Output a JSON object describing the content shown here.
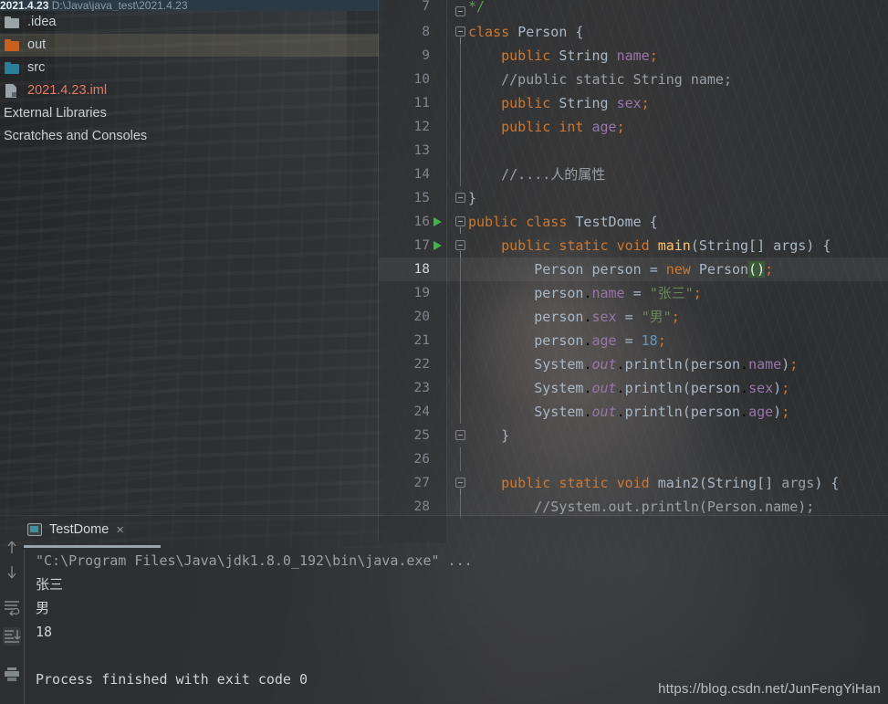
{
  "titlebar": {
    "project": "2021.4.23",
    "path": "D:\\Java\\java_test\\2021.4.23"
  },
  "project_tree": {
    "items": [
      {
        "label": ".idea",
        "icon": "folder-icon",
        "color": "#9aa3a8",
        "selected": false,
        "kind": "folder"
      },
      {
        "label": "out",
        "icon": "folder-icon",
        "color": "#c9601f",
        "selected": true,
        "kind": "folder"
      },
      {
        "label": "src",
        "icon": "folder-icon",
        "color": "#2b7f99",
        "selected": false,
        "kind": "folder"
      },
      {
        "label": "2021.4.23.iml",
        "icon": "module-file-icon",
        "color": "#e07b68",
        "selected": false,
        "kind": "module"
      },
      {
        "label": "External Libraries",
        "icon": "",
        "color": "#c9d1d6",
        "selected": false,
        "kind": "plain"
      },
      {
        "label": "Scratches and Consoles",
        "icon": "",
        "color": "#c9d1d6",
        "selected": false,
        "kind": "plain"
      }
    ]
  },
  "editor": {
    "current_line": 18,
    "lines": [
      {
        "n": "7",
        "run": false,
        "fold": "close",
        "html": "<span class=\"cmt2\">*/</span>",
        "partial": true
      },
      {
        "n": "8",
        "run": false,
        "fold": "open",
        "html": "<span class=\"kw\">class</span> <span class=\"typ\">Person</span> <span class=\"brc\">{</span>"
      },
      {
        "n": "9",
        "run": false,
        "fold": "",
        "html": "    <span class=\"kw\">public</span> <span class=\"typ\">String</span> <span class=\"fld\">name</span><span class=\"sem\">;</span>"
      },
      {
        "n": "10",
        "run": false,
        "fold": "",
        "html": "    <span class=\"cmt\">//public static String name;</span>"
      },
      {
        "n": "11",
        "run": false,
        "fold": "",
        "html": "    <span class=\"kw\">public</span> <span class=\"typ\">String</span> <span class=\"fld\">sex</span><span class=\"sem\">;</span>"
      },
      {
        "n": "12",
        "run": false,
        "fold": "",
        "html": "    <span class=\"kw\">public</span> <span class=\"kw\">int</span> <span class=\"fld\">age</span><span class=\"sem\">;</span>"
      },
      {
        "n": "13",
        "run": false,
        "fold": "",
        "html": ""
      },
      {
        "n": "14",
        "run": false,
        "fold": "",
        "html": "    <span class=\"cmt\">//....人的属性</span>"
      },
      {
        "n": "15",
        "run": false,
        "fold": "close",
        "html": "<span class=\"brc\">}</span>"
      },
      {
        "n": "16",
        "run": true,
        "fold": "open",
        "html": "<span class=\"kw\">public</span> <span class=\"kw\">class</span> <span class=\"typ\">TestDome</span> <span class=\"brc\">{</span>"
      },
      {
        "n": "17",
        "run": true,
        "fold": "open",
        "html": "    <span class=\"kw\">public</span> <span class=\"kw\">static</span> <span class=\"kw\">void</span> <span class=\"mtd\">main</span><span class=\"brc\">(</span><span class=\"typ\">String[]</span> <span class=\"pln\">args</span><span class=\"brc\">) {</span>"
      },
      {
        "n": "18",
        "run": false,
        "fold": "",
        "html": "        <span class=\"typ\">Person</span> <span class=\"pln\">person</span> <span class=\"pln\">=</span> <span class=\"kw\">new</span> <span class=\"typ\">Person</span><span class=\"brcmatch\">()</span><span class=\"sem\">;</span>"
      },
      {
        "n": "19",
        "run": false,
        "fold": "",
        "html": "        <span class=\"pln\">person</span>.<span class=\"fld\">name</span> <span class=\"pln\">=</span> <span class=\"str\">\"张三\"</span><span class=\"sem\">;</span>"
      },
      {
        "n": "20",
        "run": false,
        "fold": "",
        "html": "        <span class=\"pln\">person</span>.<span class=\"fld\">sex</span> <span class=\"pln\">=</span> <span class=\"str\">\"男\"</span><span class=\"sem\">;</span>"
      },
      {
        "n": "21",
        "run": false,
        "fold": "",
        "html": "        <span class=\"pln\">person</span>.<span class=\"fld\">age</span> <span class=\"pln\">=</span> <span class=\"num\">18</span><span class=\"sem\">;</span>"
      },
      {
        "n": "22",
        "run": false,
        "fold": "",
        "html": "        <span class=\"typ\">System</span>.<span class=\"sfld\">out</span>.<span class=\"pln\">println</span><span class=\"brc\">(</span><span class=\"pln\">person</span>.<span class=\"fld\">name</span><span class=\"brc\">)</span><span class=\"sem\">;</span>"
      },
      {
        "n": "23",
        "run": false,
        "fold": "",
        "html": "        <span class=\"typ\">System</span>.<span class=\"sfld\">out</span>.<span class=\"pln\">println</span><span class=\"brc\">(</span><span class=\"pln\">person</span>.<span class=\"fld\">sex</span><span class=\"brc\">)</span><span class=\"sem\">;</span>"
      },
      {
        "n": "24",
        "run": false,
        "fold": "",
        "html": "        <span class=\"typ\">System</span>.<span class=\"sfld\">out</span>.<span class=\"pln\">println</span><span class=\"brc\">(</span><span class=\"pln\">person</span>.<span class=\"fld\">age</span><span class=\"brc\">)</span><span class=\"sem\">;</span>"
      },
      {
        "n": "25",
        "run": false,
        "fold": "close",
        "html": "    <span class=\"brc\">}</span>"
      },
      {
        "n": "26",
        "run": false,
        "fold": "",
        "html": ""
      },
      {
        "n": "27",
        "run": false,
        "fold": "open",
        "html": "    <span class=\"kw\">public</span> <span class=\"kw\">static</span> <span class=\"kw\">void</span> <span class=\"pln\">main2</span><span class=\"brc\">(</span><span class=\"typ\">String[]</span> <span class=\"cmt\">args</span><span class=\"brc\">) {</span>"
      },
      {
        "n": "28",
        "run": false,
        "fold": "",
        "html": "        <span class=\"cmt\">//System.out.println(Person.name);</span>"
      }
    ]
  },
  "run_panel": {
    "tab_label": "TestDome",
    "tab_close": "×",
    "toolbar_icons": [
      "scroll-up-icon",
      "scroll-down-icon",
      "soft-wrap-icon",
      "scroll-to-end-icon",
      "print-icon"
    ],
    "console_lines": [
      {
        "text": "\"C:\\Program Files\\Java\\jdk1.8.0_192\\bin\\java.exe\" ...",
        "style": "cmd"
      },
      {
        "text": "张三",
        "style": "out"
      },
      {
        "text": "男",
        "style": "out"
      },
      {
        "text": "18",
        "style": "out"
      },
      {
        "text": "",
        "style": "out"
      },
      {
        "text": "Process finished with exit code 0",
        "style": "out"
      }
    ]
  },
  "watermark": {
    "text": "https://blog.csdn.net/JunFengYiHan"
  }
}
